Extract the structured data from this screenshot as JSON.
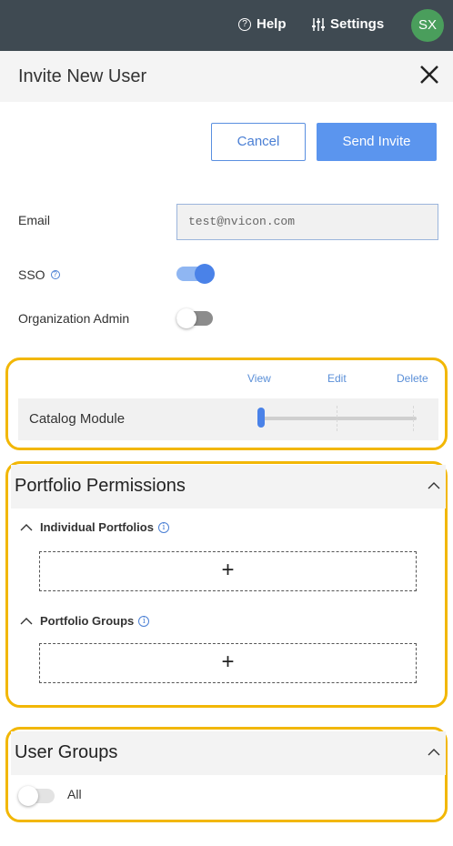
{
  "topbar": {
    "help_label": "Help",
    "settings_label": "Settings",
    "avatar_initials": "SX",
    "avatar_color": "#4a9e5c",
    "bg_color": "#3f4a52"
  },
  "header": {
    "title": "Invite New User"
  },
  "actions": {
    "cancel_label": "Cancel",
    "send_label": "Send Invite",
    "accent_color": "#5b95ee"
  },
  "form": {
    "email_label": "Email",
    "email_value": "test@nvicon.com",
    "sso_label": "SSO",
    "sso_enabled": true,
    "admin_label": "Organization Admin",
    "admin_enabled": false
  },
  "permissions": {
    "levels": [
      "View",
      "Edit",
      "Delete"
    ],
    "modules": [
      {
        "label": "Catalog Module",
        "level": "View"
      }
    ]
  },
  "portfolio_permissions": {
    "title": "Portfolio Permissions",
    "individual_label": "Individual Portfolios",
    "groups_label": "Portfolio Groups",
    "add_symbol": "+"
  },
  "user_groups": {
    "title": "User Groups",
    "all_label": "All",
    "all_enabled": false
  },
  "highlight_color": "#f2b705"
}
